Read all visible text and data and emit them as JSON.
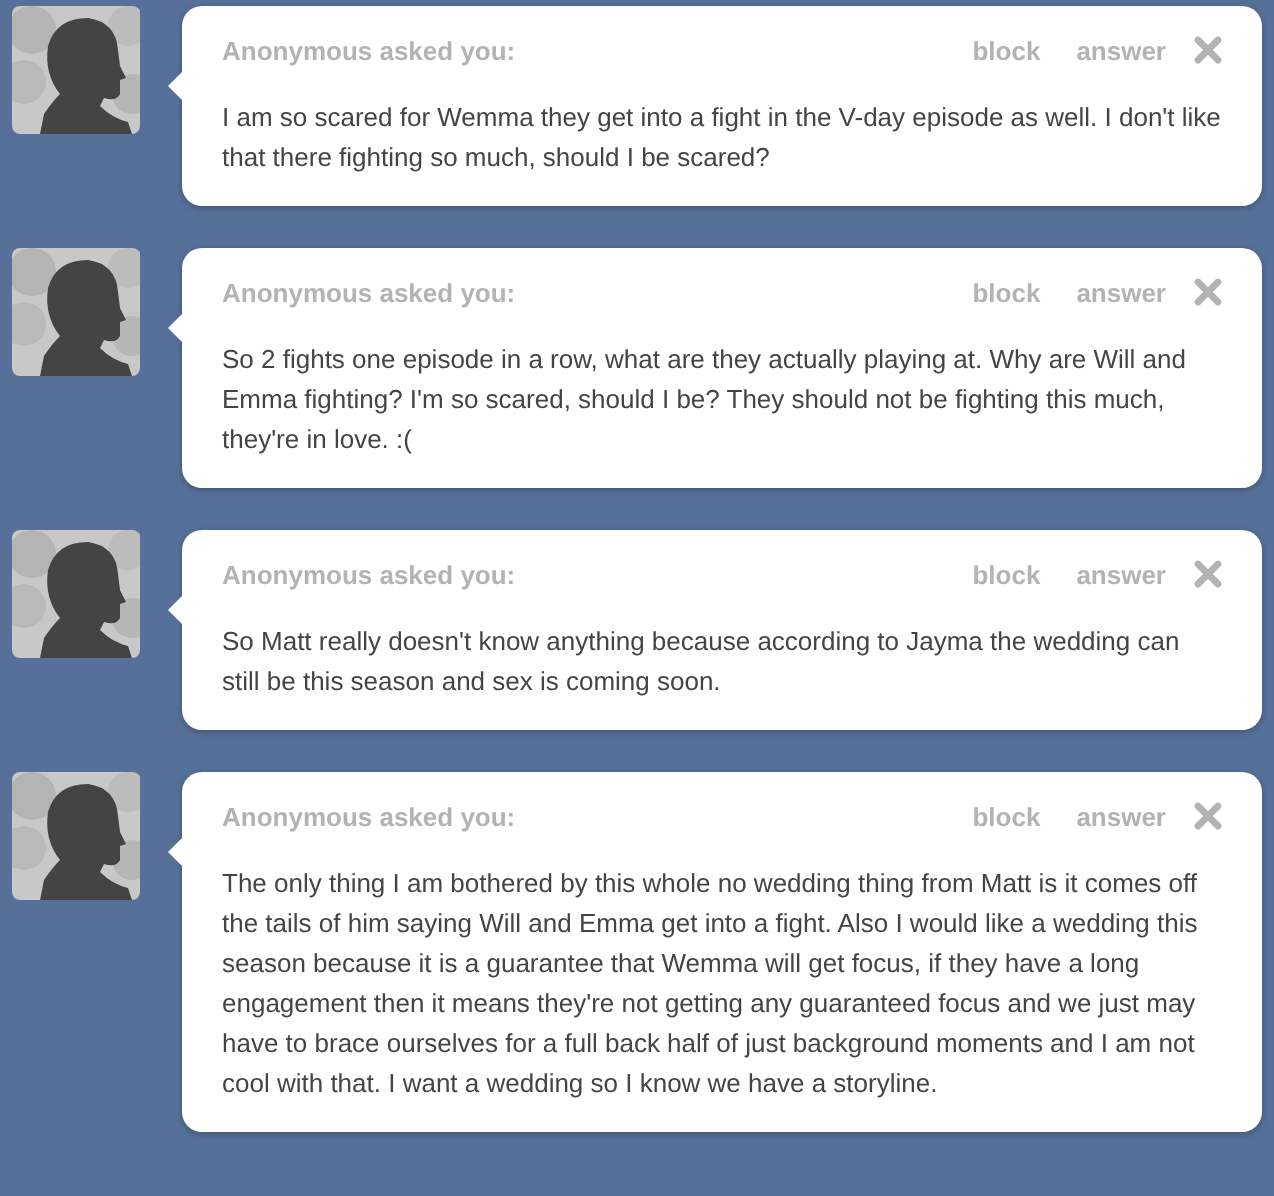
{
  "questions": [
    {
      "asker": "Anonymous asked you:",
      "actions": [
        "block",
        "answer"
      ],
      "text": "I am so scared for Wemma they get into a fight in the V-day episode as well. I don't like that there fighting so much, should I be scared?"
    },
    {
      "asker": "Anonymous asked you:",
      "actions": [
        "block",
        "answer"
      ],
      "text": "So 2 fights one episode in a row, what are they actually playing at. Why are Will and Emma fighting? I'm so scared, should I be? They should not be fighting this much, they're in love. :("
    },
    {
      "asker": "Anonymous asked you:",
      "actions": [
        "block",
        "answer"
      ],
      "text": "So Matt really doesn't know anything because according to Jayma the wedding can still be this season and sex is coming soon."
    },
    {
      "asker": "Anonymous asked you:",
      "actions": [
        "block",
        "answer"
      ],
      "text": "The only thing I am bothered by this whole no wedding thing from Matt is it comes off the tails of him saying Will and Emma get into a fight. Also I would like a wedding this season because it is a guarantee that Wemma will get focus, if they have a long engagement then it means they're not getting any guaranteed focus and we just may have to brace ourselves for a full back half of just background moments and I am not cool with that. I want a wedding so I know we have a storyline."
    }
  ]
}
